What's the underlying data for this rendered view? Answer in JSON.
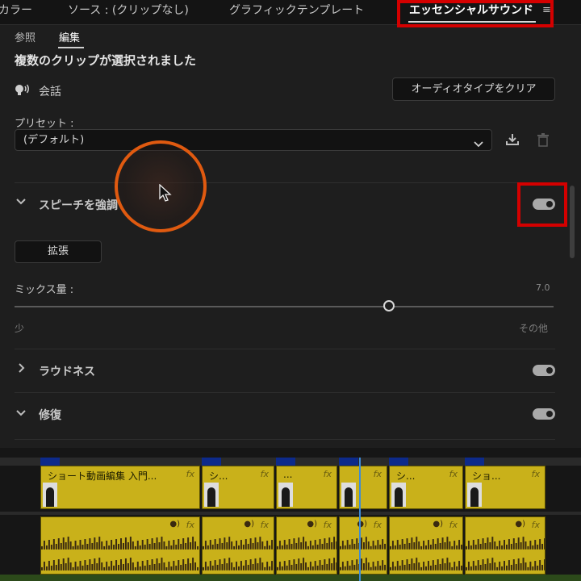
{
  "tabs": [
    "カラー",
    "ソース : (クリップなし)",
    "グラフィックテンプレート",
    "エッセンシャルサウンド"
  ],
  "tab_menu_icon": "≡",
  "subtabs": [
    "参照",
    "編集"
  ],
  "heading": "複数のクリップが選択されました",
  "audio_type": {
    "label": "会話",
    "icon": "speech-icon"
  },
  "clear_button": "オーディオタイプをクリア",
  "preset": {
    "label": "プリセット :",
    "value": "(デフォルト)"
  },
  "speech_section": {
    "title": "スピーチを強調",
    "enabled": true
  },
  "enhance_button": "拡張",
  "mix": {
    "label": "ミックス量 :",
    "value": "7.0",
    "min_label": "少",
    "max_label": "その他",
    "fraction": 0.7
  },
  "loudness_section": {
    "title": "ラウドネス",
    "enabled": true
  },
  "repair_section": {
    "title": "修復",
    "enabled": true
  },
  "clips": [
    {
      "title": "ショート動画編集 入門...",
      "fx": "fx"
    },
    {
      "title": "シ...",
      "fx": "fx"
    },
    {
      "title": "...",
      "fx": "fx"
    },
    {
      "title": "",
      "fx": "fx"
    },
    {
      "title": "シ...",
      "fx": "fx"
    },
    {
      "title": "ショ...",
      "fx": "fx"
    }
  ],
  "colors": {
    "accent_red": "#d40000",
    "clip_yellow": "#c9b11a",
    "cursor_ring": "#e05a10"
  }
}
